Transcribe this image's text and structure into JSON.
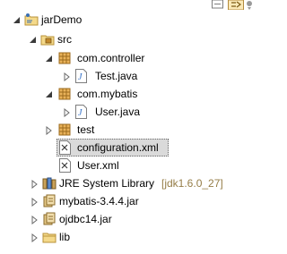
{
  "toolbar": {
    "icons": [
      "restore-icon",
      "link-with-editor-icon",
      "view-menu-icon"
    ]
  },
  "tree": {
    "project": {
      "label": "jarDemo",
      "icon": "java-project-icon",
      "expanded": true
    },
    "src": {
      "label": "src",
      "icon": "source-folder-icon",
      "expanded": true
    },
    "pkg_controller": {
      "label": "com.controller",
      "icon": "package-icon",
      "expanded": true
    },
    "test_java": {
      "label": "Test.java",
      "icon": "java-file-icon"
    },
    "pkg_mybatis": {
      "label": "com.mybatis",
      "icon": "package-icon",
      "expanded": true
    },
    "user_java": {
      "label": "User.java",
      "icon": "java-file-icon"
    },
    "pkg_test": {
      "label": "test",
      "icon": "package-icon",
      "expanded": false
    },
    "configuration_xml": {
      "label": "configuration.xml",
      "icon": "xml-file-icon",
      "selected": true
    },
    "user_xml": {
      "label": "User.xml",
      "icon": "xml-file-icon"
    },
    "jre": {
      "label": "JRE System Library",
      "decoration": "[jdk1.6.0_27]",
      "icon": "library-icon",
      "expanded": false
    },
    "mybatis_jar": {
      "label": "mybatis-3.4.4.jar",
      "icon": "jar-icon",
      "expanded": false
    },
    "ojdbc_jar": {
      "label": "ojdbc14.jar",
      "icon": "jar-icon",
      "expanded": false
    },
    "lib": {
      "label": "lib",
      "icon": "folder-icon",
      "expanded": false
    }
  },
  "colors": {
    "selection": "#dadada",
    "decoration": "#957d47",
    "package": "#c48a2c",
    "java": "#2f6ec7",
    "folder": "#e8c56a"
  }
}
